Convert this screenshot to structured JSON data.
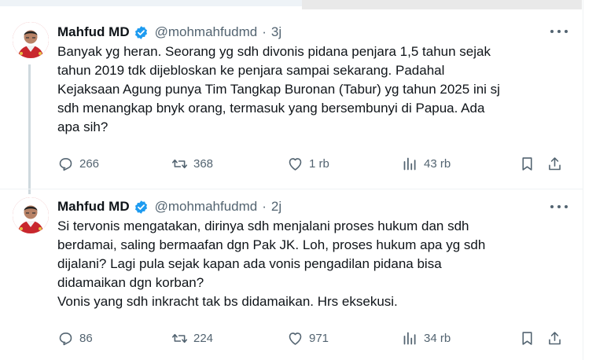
{
  "tweets": [
    {
      "name": "Mahfud MD",
      "handle": "@mohmahfudmd",
      "separator": "·",
      "time": "3j",
      "text": "Banyak yg heran. Seorang yg sdh divonis pidana penjara 1,5 tahun sejak\ntahun 2019 tdk dijebloskan ke penjara sampai sekarang. Padahal\nKejaksaan Agung punya Tim Tangkap Buronan (Tabur) yg tahun 2025 ini sj\nsdh menangkap bnyk orang, termasuk yang bersembunyi di Papua. Ada\napa sih?",
      "replies": "266",
      "reposts": "368",
      "likes": "1 rb",
      "views": "43 rb"
    },
    {
      "name": "Mahfud MD",
      "handle": "@mohmahfudmd",
      "separator": "·",
      "time": "2j",
      "text": "Si tervonis mengatakan, dirinya sdh menjalani proses hukum dan sdh\nberdamai, saling bermaafan dgn Pak JK. Loh, proses hukum apa yg sdh\ndijalani? Lagi pula sejak kapan ada vonis pengadilan pidana bisa\ndidamaikan dgn korban?\nVonis yang sdh inkracht tak bs didamaikan. Hrs eksekusi.",
      "replies": "86",
      "reposts": "224",
      "likes": "971",
      "views": "34 rb"
    }
  ],
  "icons": {
    "verified": "verified-badge-icon",
    "more": "more-options-icon",
    "reply": "reply-icon",
    "repost": "repost-icon",
    "like": "heart-icon",
    "views": "views-icon",
    "bookmark": "bookmark-icon",
    "share": "share-icon"
  },
  "colors": {
    "verified_blue": "#1d9bf0",
    "secondary_text": "#536471",
    "avatar_bg": "#c8272d"
  }
}
